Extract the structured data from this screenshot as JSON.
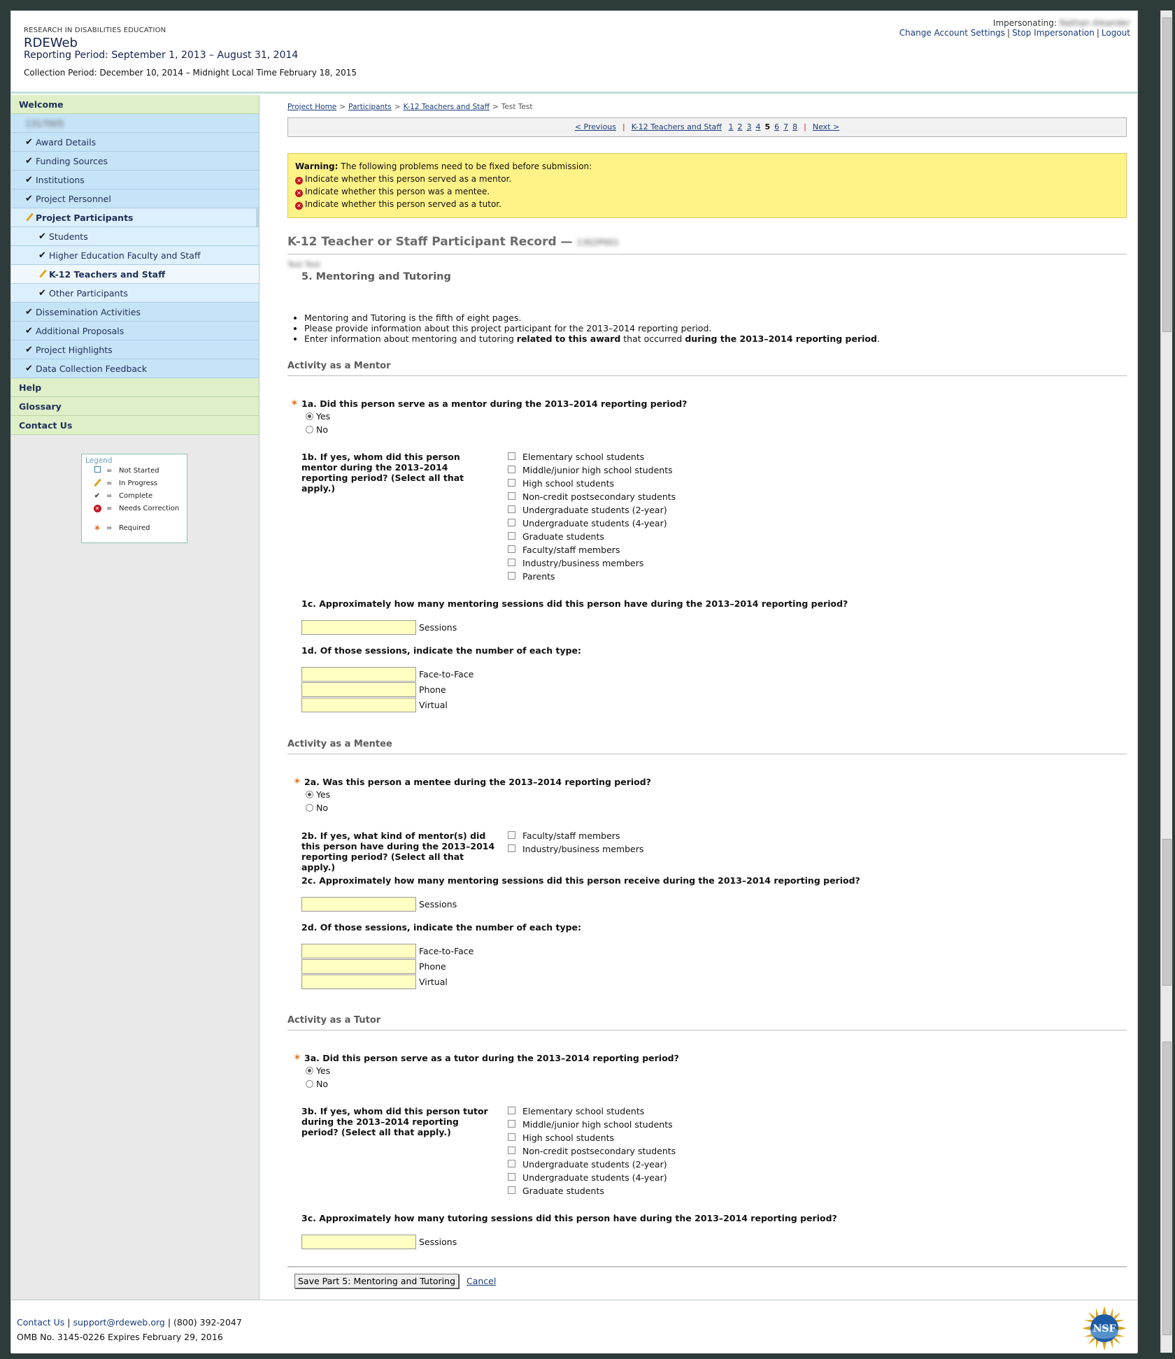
{
  "header": {
    "org": "RESEARCH IN DISABILITIES EDUCATION",
    "app_title": "RDEWeb",
    "reporting_period": "Reporting Period: September 1, 2013 – August 31, 2014",
    "collection_period": "Collection Period: December 10, 2014 – Midnight Local Time February 18, 2015",
    "impersonating_label": "Impersonating:",
    "impersonated_user": "Nathan Aleander",
    "links": {
      "change_settings": "Change Account Settings",
      "stop_impersonation": "Stop Impersonation",
      "logout": "Logout",
      "sep": "|"
    }
  },
  "sidebar": {
    "welcome": "Welcome",
    "award_id": "1317005",
    "items": [
      {
        "label": "Award Details"
      },
      {
        "label": "Funding Sources"
      },
      {
        "label": "Institutions"
      },
      {
        "label": "Project Personnel"
      },
      {
        "label": "Project Participants"
      },
      {
        "label": "Students"
      },
      {
        "label": "Higher Education Faculty and Staff"
      },
      {
        "label": "K-12 Teachers and Staff"
      },
      {
        "label": "Other Participants"
      },
      {
        "label": "Dissemination Activities"
      },
      {
        "label": "Additional Proposals"
      },
      {
        "label": "Project Highlights"
      },
      {
        "label": "Data Collection Feedback"
      }
    ],
    "help": "Help",
    "glossary": "Glossary",
    "contact": "Contact Us",
    "legend": {
      "title": "Legend",
      "eq": "=",
      "not_started": "Not Started",
      "in_progress": "In Progress",
      "complete": "Complete",
      "needs_correction": "Needs Correction",
      "required": "Required"
    }
  },
  "breadcrumb": {
    "home": "Project Home",
    "participants": "Participants",
    "k12": "K-12 Teachers and Staff",
    "current": "Test Test",
    "sep": ">"
  },
  "pager": {
    "previous": "< Previous",
    "section": "K-12 Teachers and Staff",
    "pages": [
      "1",
      "2",
      "3",
      "4",
      "5",
      "6",
      "7",
      "8"
    ],
    "current": "5",
    "next": "Next >",
    "sep": "|"
  },
  "warning": {
    "lead": "Warning:",
    "text": "The following problems need to be fixed before submission:",
    "items": [
      "Indicate whether this person served as a mentor.",
      "Indicate whether this person was a mentee.",
      "Indicate whether this person served as a tutor."
    ]
  },
  "record": {
    "title": "K-12 Teacher or Staff Participant Record —",
    "record_id": "1302P001",
    "name": "Test Test",
    "section_title": "5. Mentoring and Tutoring",
    "intro": [
      "Mentoring and Tutoring is the fifth of eight pages.",
      "Please provide information about this project participant for the 2013–2014 reporting period.",
      "Enter information about mentoring and tutoring"
    ],
    "intro_bold_1": "related to this award",
    "intro_mid": "that occurred",
    "intro_bold_2": "during the 2013–2014 reporting period",
    "intro_end": "."
  },
  "mentor": {
    "heading": "Activity as a Mentor",
    "q1a": "1a. Did this person serve as a mentor during the 2013–2014 reporting period?",
    "yes": "Yes",
    "no": "No",
    "q1b": "1b. If yes, whom did this person mentor during the 2013–2014 reporting period? (Select all that apply.)",
    "options": [
      "Elementary school students",
      "Middle/junior high school students",
      "High school students",
      "Non-credit postsecondary students",
      "Undergraduate students (2-year)",
      "Undergraduate students (4-year)",
      "Graduate students",
      "Faculty/staff members",
      "Industry/business members",
      "Parents"
    ],
    "q1c": "1c. Approximately how many mentoring sessions did this person have during the 2013–2014 reporting period?",
    "sessions": "Sessions",
    "q1d": "1d. Of those sessions, indicate the number of each type:",
    "types": [
      "Face-to-Face",
      "Phone",
      "Virtual"
    ]
  },
  "mentee": {
    "heading": "Activity as a Mentee",
    "q2a": "2a. Was this person a mentee during the 2013–2014 reporting period?",
    "yes": "Yes",
    "no": "No",
    "q2b": "2b. If yes, what kind of mentor(s) did this person have during the 2013–2014 reporting period? (Select all that apply.)",
    "options": [
      "Faculty/staff members",
      "Industry/business members"
    ],
    "q2c": "2c. Approximately how many mentoring sessions did this person receive during the 2013–2014 reporting period?",
    "sessions": "Sessions",
    "q2d": "2d. Of those sessions, indicate the number of each type:",
    "types": [
      "Face-to-Face",
      "Phone",
      "Virtual"
    ]
  },
  "tutor": {
    "heading": "Activity as a Tutor",
    "q3a": "3a. Did this person serve as a tutor during the 2013–2014 reporting period?",
    "yes": "Yes",
    "no": "No",
    "q3b": "3b. If yes, whom did this person tutor during the 2013–2014 reporting period? (Select all that apply.)",
    "options": [
      "Elementary school students",
      "Middle/junior high school students",
      "High school students",
      "Non-credit postsecondary students",
      "Undergraduate students (2-year)",
      "Undergraduate students (4-year)",
      "Graduate students"
    ],
    "q3c": "3c. Approximately how many tutoring sessions did this person have during the 2013–2014 reporting period?",
    "sessions": "Sessions"
  },
  "actions": {
    "save": "Save Part 5: Mentoring and Tutoring",
    "cancel": "Cancel"
  },
  "footer": {
    "contact": "Contact Us",
    "email": "support@rdeweb.org",
    "phone": "(800) 392-2047",
    "sep": "|",
    "omb": "OMB No. 3145-0226 Expires February 29, 2016",
    "logo_text": "NSF"
  }
}
